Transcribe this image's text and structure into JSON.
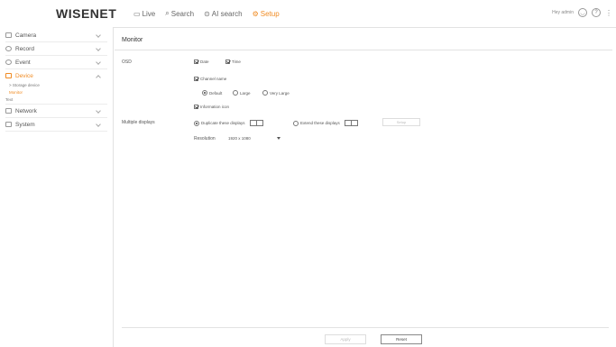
{
  "header": {
    "logo": "WISENET",
    "nav": [
      {
        "label": "Live",
        "icon": "monitor-icon"
      },
      {
        "label": "Search",
        "icon": "search-icon"
      },
      {
        "label": "AI search",
        "icon": "ai-search-icon"
      },
      {
        "label": "Setup",
        "icon": "gear-icon"
      }
    ],
    "right_text": "Hey admin",
    "accent": "#f08c24"
  },
  "sidebar": {
    "items": [
      {
        "label": "Camera",
        "icon": "camera-icon"
      },
      {
        "label": "Record",
        "icon": "record-icon"
      },
      {
        "label": "Event",
        "icon": "event-icon"
      },
      {
        "label": "Device",
        "icon": "device-icon"
      },
      {
        "label": "Network",
        "icon": "network-icon"
      },
      {
        "label": "System",
        "icon": "system-icon"
      }
    ],
    "subitems": [
      "> Storage device",
      "Monitor",
      "Text"
    ]
  },
  "main": {
    "title": "Monitor",
    "osd_label": "OSD",
    "osd_date": "Date",
    "osd_time": "Time",
    "channel_name": "Channel name",
    "size_default": "Default",
    "size_large": "Large",
    "size_very_large": "Very Large",
    "information_icon": "Information icon",
    "multiple_displays_label": "Multiple displays",
    "duplicate_displays": "Duplicate these displays",
    "extend_displays": "Extend these displays",
    "setup_button": "Setup",
    "resolution_label": "Resolution",
    "resolution_value": "1920 x 1080"
  },
  "footer": {
    "apply": "Apply",
    "reset": "Reset"
  }
}
